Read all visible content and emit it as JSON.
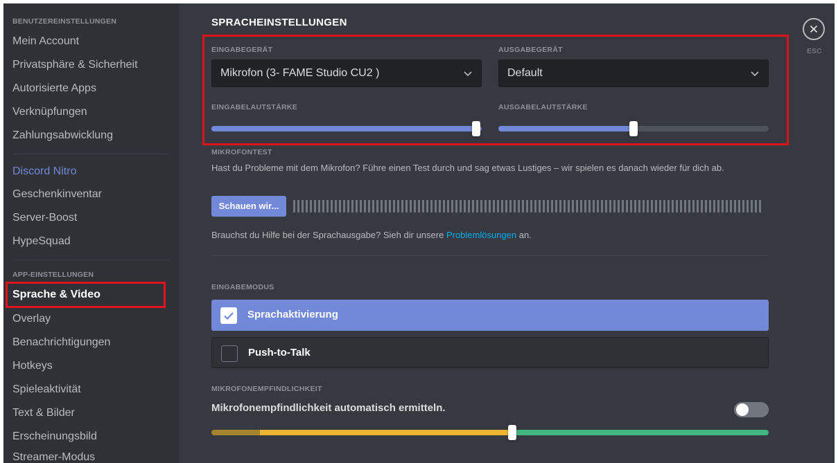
{
  "sidebar": {
    "user_settings_header": "BENUTZEREINSTELLUNGEN",
    "user_items": [
      "Mein Account",
      "Privatsphäre & Sicherheit",
      "Autorisierte Apps",
      "Verknüpfungen",
      "Zahlungsabwicklung"
    ],
    "nitro_items": [
      "Discord Nitro",
      "Geschenkinventar",
      "Server-Boost",
      "HypeSquad"
    ],
    "app_settings_header": "APP-EINSTELLUNGEN",
    "app_items": [
      "Sprache & Video",
      "Overlay",
      "Benachrichtigungen",
      "Hotkeys",
      "Spieleaktivität",
      "Text & Bilder",
      "Erscheinungsbild",
      "Streamer-Modus"
    ],
    "active_item": "Sprache & Video"
  },
  "main": {
    "title": "SPRACHEINSTELLUNGEN",
    "input_device_label": "EINGABEGERÄT",
    "input_device_value": "Mikrofon (3- FAME Studio CU2 )",
    "output_device_label": "AUSGABEGERÄT",
    "output_device_value": "Default",
    "input_volume_label": "EINGABELAUTSTÄRKE",
    "input_volume_level": 1.0,
    "output_volume_label": "AUSGABELAUTSTÄRKE",
    "output_volume_level": 0.5,
    "mic_test_label": "MIKROFONTEST",
    "mic_test_text": "Hast du Probleme mit dem Mikrofon? Führe einen Test durch und sag etwas Lustiges – wir spielen es danach wieder für dich ab.",
    "mic_test_button": "Schauen wir...",
    "help_text_before": "Brauchst du Hilfe bei der Sprachausgabe? Sieh dir unsere ",
    "help_link": "Problemlösungen",
    "help_text_after": " an.",
    "input_mode_label": "EINGABEMODUS",
    "input_mode_options": [
      "Sprachaktivierung",
      "Push-to-Talk"
    ],
    "input_mode_selected": "Sprachaktivierung",
    "sensitivity_label": "MIKROFONEMPFINDLICHKEIT",
    "sensitivity_auto_text": "Mikrofonempfindlichkeit automatisch ermitteln.",
    "sensitivity_auto_enabled": false,
    "sensitivity_threshold": 0.54
  },
  "close": {
    "esc_label": "ESC"
  },
  "colors": {
    "accent": "#7289da",
    "highlight_box": "#e0121b",
    "link": "#00b0f4",
    "sens_low": "#f0b232",
    "sens_high": "#43b581"
  }
}
